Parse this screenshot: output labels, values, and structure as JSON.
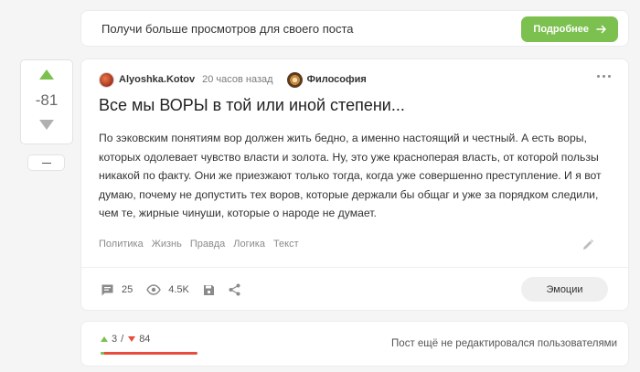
{
  "promo": {
    "text": "Получи больше просмотров для своего поста",
    "button_label": "Подробнее"
  },
  "vote": {
    "score": "-81"
  },
  "post": {
    "author": "Alyoshka.Kotov",
    "time": "20 часов назад",
    "community": "Философия",
    "title": "Все мы ВОРЫ в той или иной степени...",
    "body": "По зэковским понятиям вор должен жить бедно, а именно настоящий и честный. А есть воры, которых одолевает чувство власти и золота. Ну, это уже красноперая власть, от которой пользы никакой по факту. Они же приезжают только тогда, когда уже совершенно преступление. И я вот думаю, почему не допустить тех воров, которые держали бы общаг и уже за порядком следили, чем те, жирные чинуши, которые о народе не думает.",
    "tags": [
      "Политика",
      "Жизнь",
      "Правда",
      "Логика",
      "Текст"
    ],
    "comments_count": "25",
    "views_count": "4.5K",
    "emotions_label": "Эмоции"
  },
  "rating": {
    "pluses": "3",
    "separator": "/",
    "minuses": "84",
    "plus_fraction": 0.034,
    "note": "Пост ещё не редактировался пользователями"
  },
  "colors": {
    "accent_green": "#7cc04f",
    "minus_red": "#e74c3c"
  },
  "icons": [
    "arrow-right-icon",
    "vote-up-icon",
    "vote-down-icon",
    "minus-icon",
    "more-dots-icon",
    "pencil-icon",
    "comment-icon",
    "eye-icon",
    "save-icon",
    "share-icon"
  ]
}
